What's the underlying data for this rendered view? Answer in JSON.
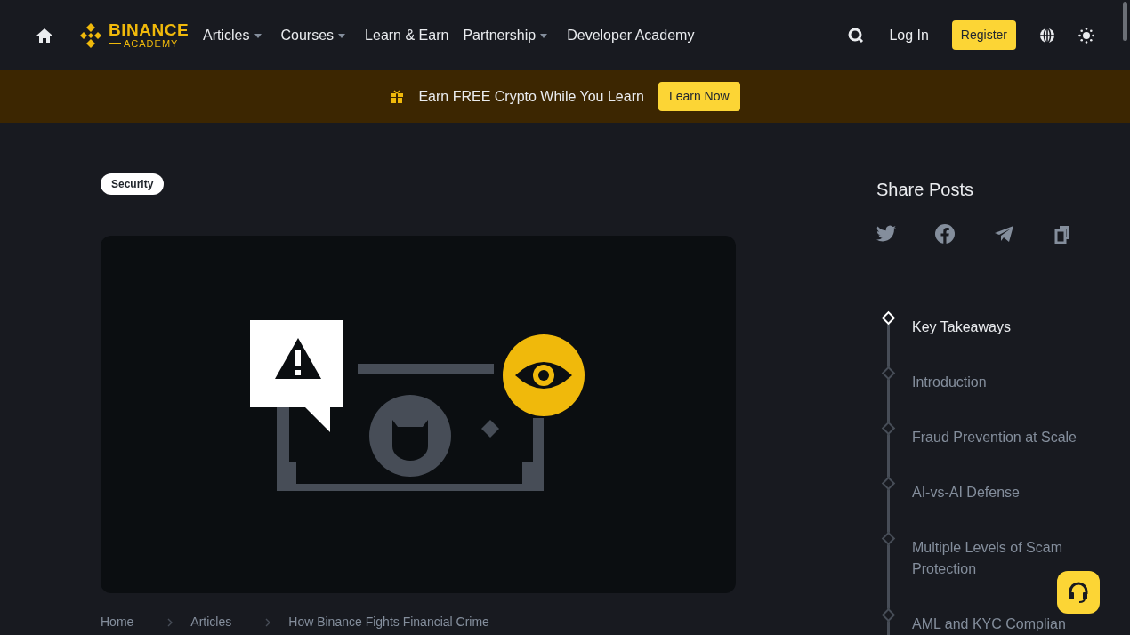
{
  "header": {
    "logo": {
      "line1": "BINANCE",
      "line2": "ACADEMY"
    },
    "nav": [
      {
        "label": "Articles",
        "has_menu": true
      },
      {
        "label": "Courses",
        "has_menu": true
      },
      {
        "label": "Learn & Earn",
        "has_menu": false
      },
      {
        "label": "Partnership",
        "has_menu": true
      },
      {
        "label": "Developer Academy",
        "has_menu": false
      }
    ],
    "login": "Log In",
    "register": "Register"
  },
  "banner": {
    "text": "Earn FREE Crypto While You Learn",
    "button": "Learn Now"
  },
  "article": {
    "tag": "Security",
    "breadcrumb": [
      "Home",
      "Articles",
      "How Binance Fights Financial Crime"
    ]
  },
  "share": {
    "title": "Share Posts",
    "buttons": [
      {
        "kind": "twitter"
      },
      {
        "kind": "facebook"
      },
      {
        "kind": "telegram"
      },
      {
        "kind": "copy"
      }
    ]
  },
  "toc": [
    {
      "label": "Key Takeaways",
      "selected": true
    },
    {
      "label": "Introduction",
      "selected": false
    },
    {
      "label": "Fraud Prevention at Scale",
      "selected": false
    },
    {
      "label": "AI-vs-AI Defense",
      "selected": false
    },
    {
      "label": "Multiple Levels of Scam Protection",
      "selected": false
    },
    {
      "label": "AML and KYC Complian",
      "selected": false
    }
  ]
}
